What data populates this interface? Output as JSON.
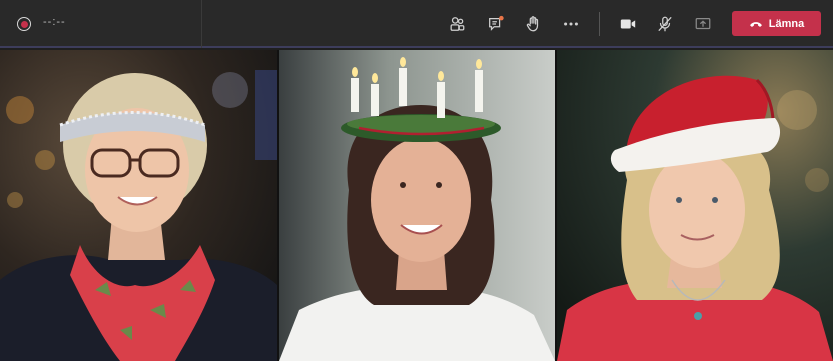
{
  "meeting": {
    "recording_icon": "record-icon",
    "timer": "--:--"
  },
  "toolbar": {
    "icons": [
      "people-icon",
      "chat-icon",
      "raise-hand-icon",
      "more-icon",
      "camera-icon",
      "mic-off-icon",
      "share-icon",
      "phone-hangup-icon"
    ],
    "leave_label": "Lämna",
    "leave_color": "#c4314b"
  },
  "participants": [
    {
      "tile": "participant-1",
      "accessory": "tinsel-crown"
    },
    {
      "tile": "participant-2",
      "accessory": "candle-wreath"
    },
    {
      "tile": "participant-3",
      "accessory": "santa-hat"
    }
  ]
}
